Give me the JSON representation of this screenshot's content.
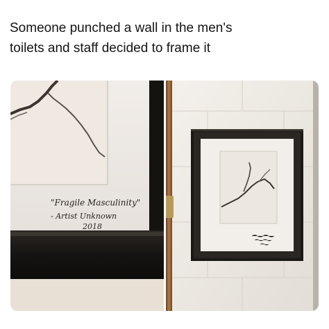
{
  "caption": {
    "line1": "Someone punched a wall in the men's",
    "line2": "toilets and staff decided to frame it"
  },
  "artwork_label": {
    "title": "\"Fragile Masculinity\"",
    "artist": "- Artist Unknown",
    "year": "2018"
  },
  "colors": {
    "wall": "#ece7df",
    "frame": "#1b1917",
    "mat": "#f2eeea",
    "pipe": "#a06a3f",
    "text": "#141414"
  }
}
